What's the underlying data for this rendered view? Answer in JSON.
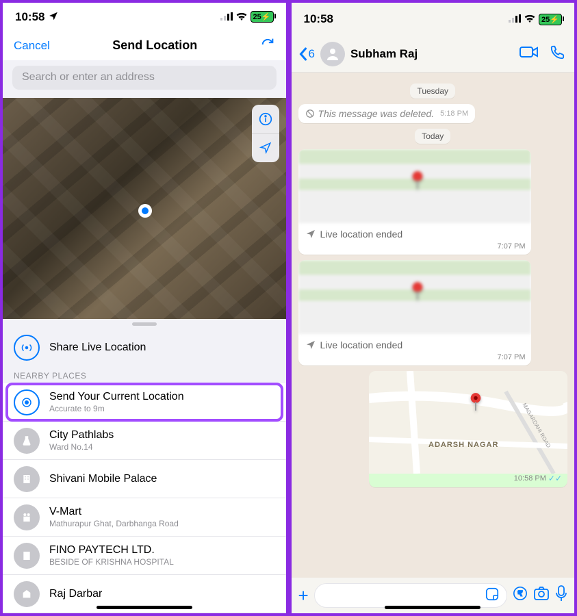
{
  "status": {
    "time": "10:58",
    "battery": "25"
  },
  "left": {
    "cancel": "Cancel",
    "title": "Send Location",
    "search_placeholder": "Search or enter an address",
    "share_live": "Share Live Location",
    "section": "NEARBY PLACES",
    "current": {
      "title": "Send Your Current Location",
      "sub": "Accurate to 9m"
    },
    "places": [
      {
        "title": "City Pathlabs",
        "sub": "Ward No.14"
      },
      {
        "title": "Shivani Mobile Palace",
        "sub": ""
      },
      {
        "title": "V-Mart",
        "sub": "Mathurapur Ghat, Darbhanga Road"
      },
      {
        "title": "FINO PAYTECH LTD.",
        "sub": "BESIDE OF KRISHNA HOSPITAL"
      },
      {
        "title": "Raj Darbar",
        "sub": ""
      }
    ]
  },
  "right": {
    "back_count": "6",
    "name": "Subham Raj",
    "date1": "Tuesday",
    "deleted": "This message was deleted.",
    "deleted_time": "5:18 PM",
    "date2": "Today",
    "live_ended": "Live location ended",
    "time1": "7:07 PM",
    "time2": "7:07 PM",
    "area": "ADARSH NAGAR",
    "road": "MAGARDAHI ROAD",
    "sent_time": "10:58 PM"
  }
}
